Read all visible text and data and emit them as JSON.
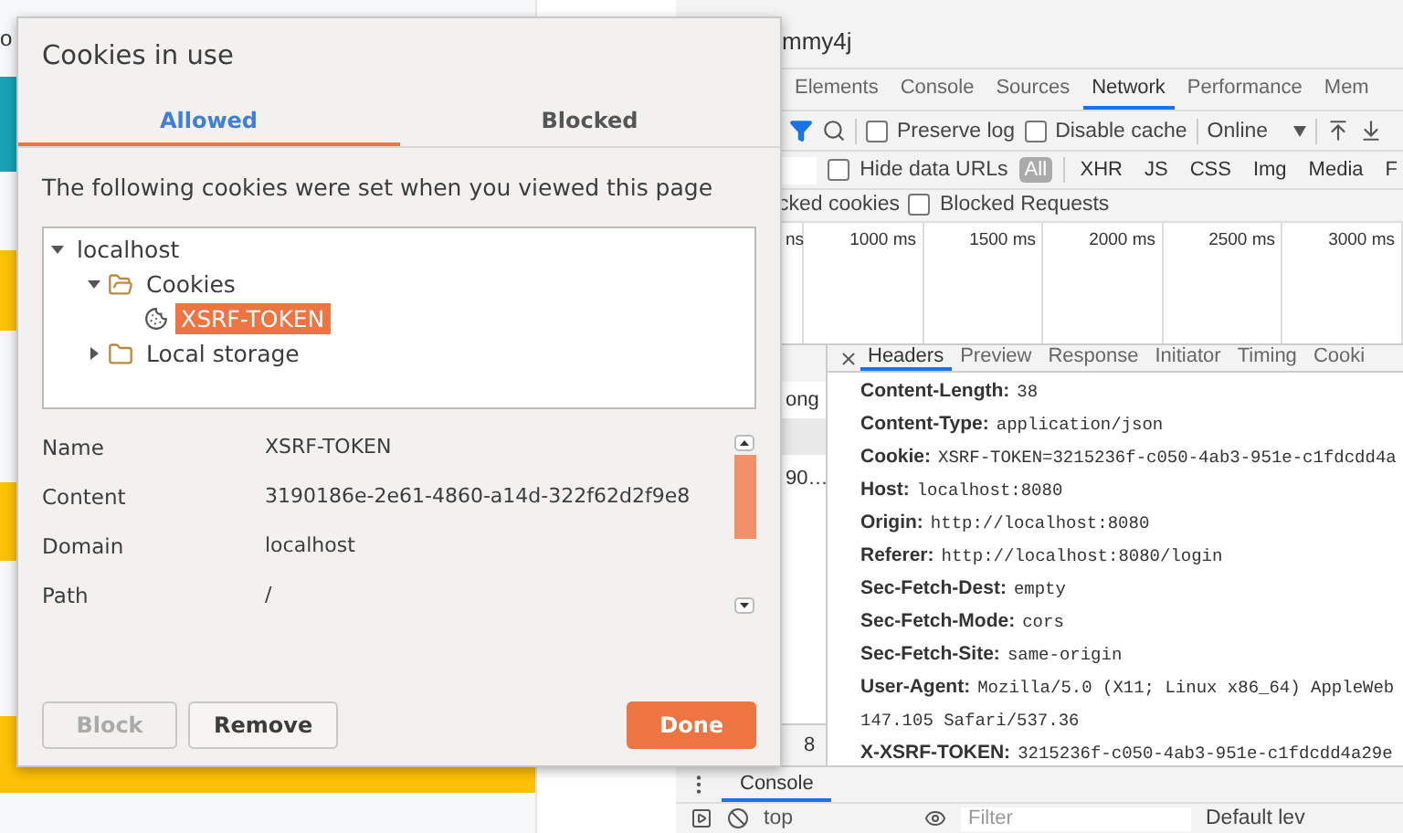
{
  "web_page": {
    "heading": "o"
  },
  "devtools": {
    "title": "mmy4j",
    "tabs": [
      {
        "label": "Elements",
        "selected": false
      },
      {
        "label": "Console",
        "selected": false
      },
      {
        "label": "Sources",
        "selected": false
      },
      {
        "label": "Network",
        "selected": true
      },
      {
        "label": "Performance",
        "selected": false
      },
      {
        "label": "Mem",
        "selected": false
      }
    ],
    "toolbar": {
      "preserve_log": {
        "label": "Preserve log",
        "checked": false
      },
      "disable_cache": {
        "label": "Disable cache",
        "checked": false
      },
      "throttling": "Online"
    },
    "filter_bar": {
      "hide_data_urls": {
        "label": "Hide data URLs",
        "checked": false
      },
      "types": [
        {
          "label": "All",
          "selected": true
        },
        {
          "label": "XHR",
          "selected": false
        },
        {
          "label": "JS",
          "selected": false
        },
        {
          "label": "CSS",
          "selected": false
        },
        {
          "label": "Img",
          "selected": false
        },
        {
          "label": "Media",
          "selected": false
        },
        {
          "label": "F",
          "selected": false
        }
      ]
    },
    "blocked_row": {
      "blocked_cookies": "cked cookies",
      "blocked_requests": {
        "label": "Blocked Requests",
        "checked": false
      }
    },
    "timeline_ticks": [
      "ns",
      "1000 ms",
      "1500 ms",
      "2000 ms",
      "2500 ms",
      "3000 ms"
    ],
    "requests": [
      {
        "text": "ong",
        "selected": false
      },
      {
        "selected": true
      },
      {
        "text": "90…",
        "selected": false
      }
    ],
    "request_footer": "8",
    "detail_tabs": [
      {
        "label": "Headers",
        "selected": true
      },
      {
        "label": "Preview",
        "selected": false
      },
      {
        "label": "Response",
        "selected": false
      },
      {
        "label": "Initiator",
        "selected": false
      },
      {
        "label": "Timing",
        "selected": false
      },
      {
        "label": "Cooki",
        "selected": false
      }
    ],
    "headers": [
      {
        "name": "Content-Length:",
        "value": "38"
      },
      {
        "name": "Content-Type:",
        "value": "application/json"
      },
      {
        "name": "Cookie:",
        "value": "XSRF-TOKEN=3215236f-c050-4ab3-951e-c1fdcdd4a"
      },
      {
        "name": "Host:",
        "value": "localhost:8080"
      },
      {
        "name": "Origin:",
        "value": "http://localhost:8080"
      },
      {
        "name": "Referer:",
        "value": "http://localhost:8080/login"
      },
      {
        "name": "Sec-Fetch-Dest:",
        "value": "empty"
      },
      {
        "name": "Sec-Fetch-Mode:",
        "value": "cors"
      },
      {
        "name": "Sec-Fetch-Site:",
        "value": "same-origin"
      },
      {
        "name": "User-Agent:",
        "value": "Mozilla/5.0 (X11; Linux x86_64) AppleWeb",
        "continuation": "147.105 Safari/537.36"
      },
      {
        "name": "X-XSRF-TOKEN:",
        "value": "3215236f-c050-4ab3-951e-c1fdcdd4a29e"
      }
    ],
    "console": {
      "tab": "Console",
      "context": "top",
      "filter_placeholder": "Filter",
      "levels": "Default lev"
    }
  },
  "dialog": {
    "title": "Cookies in use",
    "tabs": [
      {
        "label": "Allowed",
        "selected": true
      },
      {
        "label": "Blocked",
        "selected": false
      }
    ],
    "description": "The following cookies were set when you viewed this page",
    "tree": [
      {
        "label": "localhost",
        "kind": "site",
        "expanded": true,
        "selected": false,
        "children": [
          {
            "label": "Cookies",
            "kind": "folder",
            "expanded": true,
            "selected": false,
            "children": [
              {
                "label": "XSRF-TOKEN",
                "kind": "cookie",
                "selected": true
              }
            ]
          },
          {
            "label": "Local storage",
            "kind": "folder",
            "expanded": false,
            "selected": false
          }
        ]
      }
    ],
    "details": [
      {
        "label": "Name",
        "value": "XSRF-TOKEN"
      },
      {
        "label": "Content",
        "value": "3190186e-2e61-4860-a14d-322f62d2f9e8"
      },
      {
        "label": "Domain",
        "value": "localhost"
      },
      {
        "label": "Path",
        "value": "/"
      }
    ],
    "buttons": [
      {
        "label": "Block",
        "kind": "secondary",
        "disabled": true
      },
      {
        "label": "Remove",
        "kind": "secondary",
        "disabled": false
      },
      {
        "label": "Done",
        "kind": "primary",
        "disabled": false
      }
    ]
  }
}
